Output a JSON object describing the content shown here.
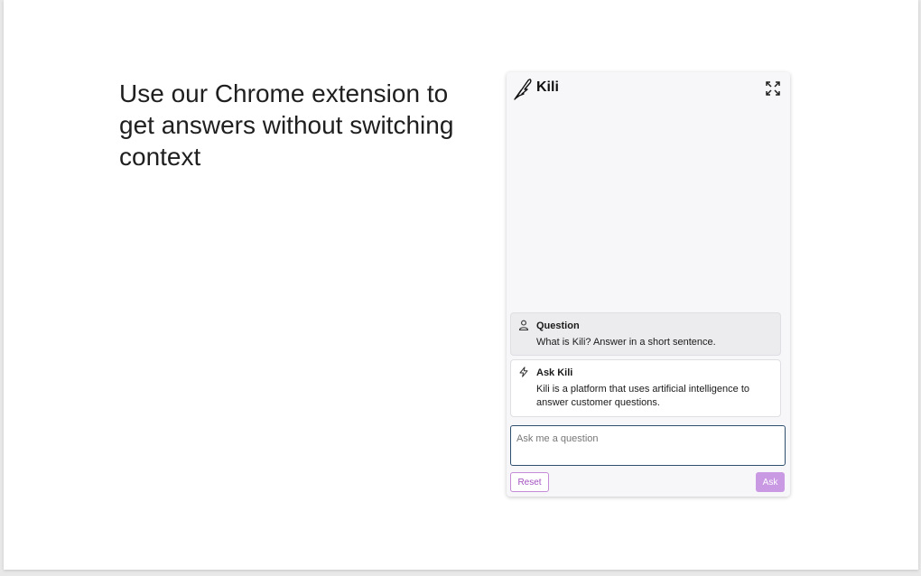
{
  "slide": {
    "headline": "Use our Chrome extension to get answers without switching context"
  },
  "extension": {
    "title": "Kili",
    "logo_icon": "feather-icon",
    "expand_icon": "expand-icon",
    "messages": [
      {
        "role": "user",
        "icon": "person-icon",
        "title": "Question",
        "text": "What is Kili? Answer in a short sentence."
      },
      {
        "role": "assistant",
        "icon": "lightning-icon",
        "title": "Ask Kili",
        "text": "Kili is a platform that uses artificial intelligence to answer customer questions."
      }
    ],
    "input": {
      "value": "",
      "placeholder": "Ask me a question"
    },
    "reset_label": "Reset",
    "ask_label": "Ask"
  },
  "colors": {
    "accent": "#c99ae3",
    "accent_text": "#a24fc0",
    "panel_bg": "#f7f7f9",
    "input_border": "#2f4f6f"
  }
}
